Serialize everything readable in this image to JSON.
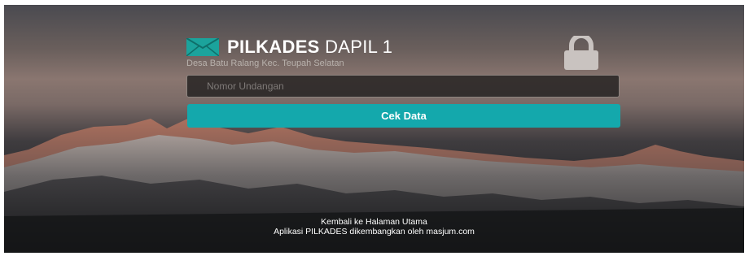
{
  "brand": {
    "title_bold": "PILKADES",
    "title_rest": "DAPIL 1",
    "subtitle": "Desa Batu Ralang Kec. Teupah Selatan"
  },
  "form": {
    "invitation_placeholder": "Nomor Undangan",
    "submit_label": "Cek Data"
  },
  "footer": {
    "home_link": "Kembali ke Halaman Utama",
    "credit": "Aplikasi PILKADES dikembangkan oleh masjum.com"
  },
  "colors": {
    "accent": "#14a8ac",
    "logo": "#1ba39c"
  },
  "icons": [
    "envelope-logo-icon",
    "lock-icon"
  ]
}
